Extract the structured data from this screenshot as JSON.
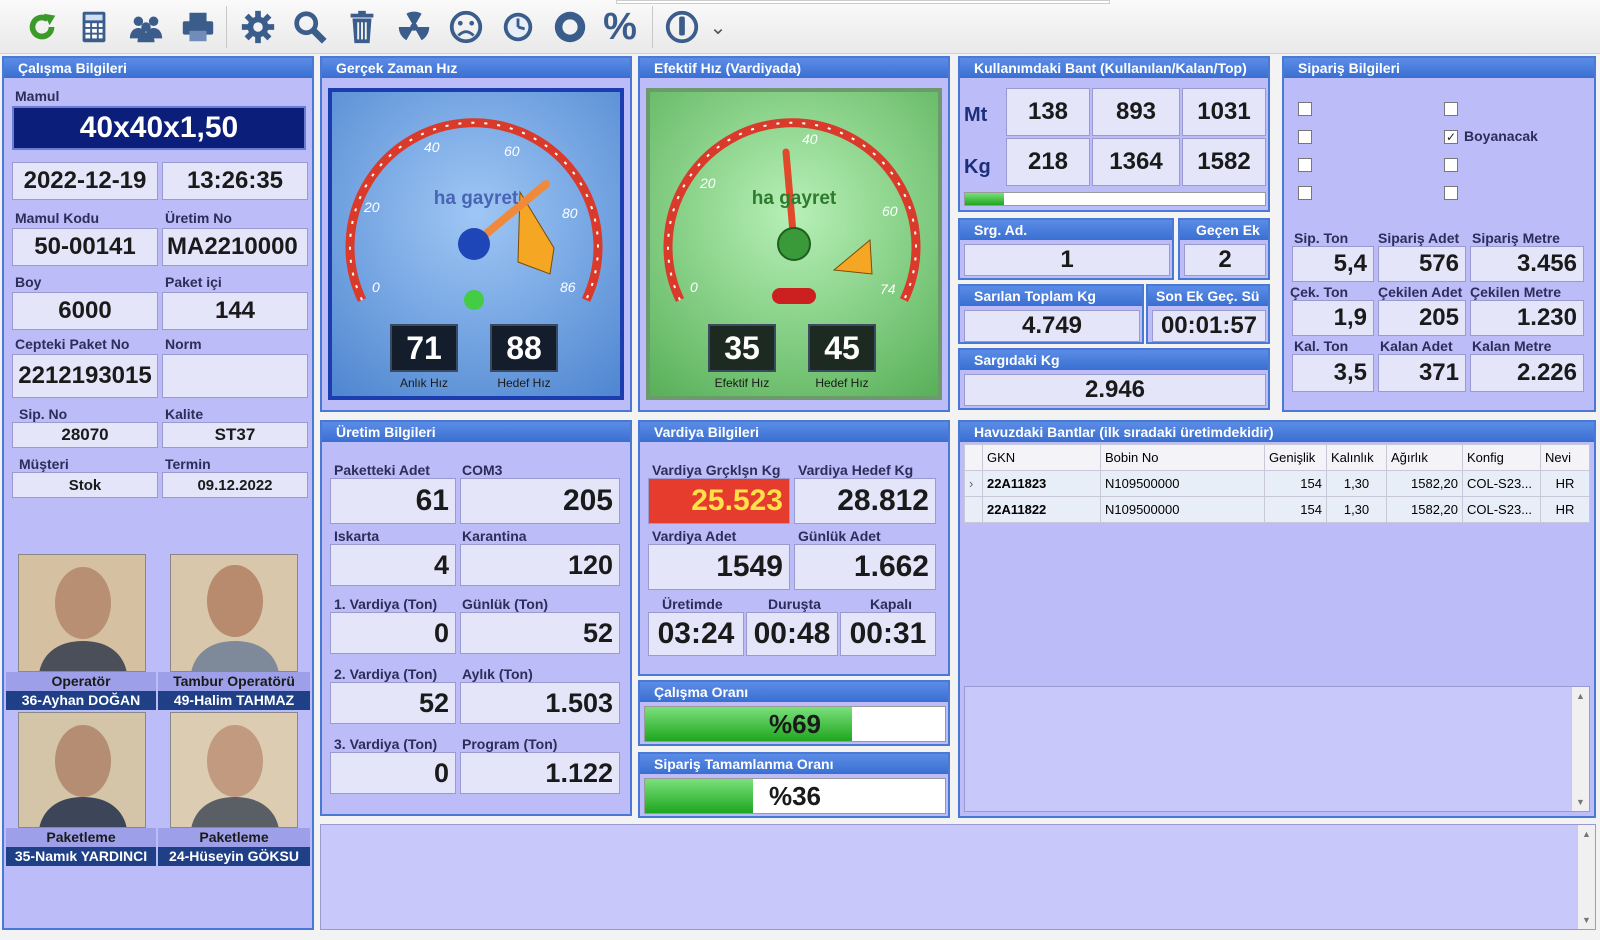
{
  "toolbar": {
    "icons": [
      "refresh-icon",
      "calculator-icon",
      "users-icon",
      "printer-icon",
      "gear-icon",
      "search-icon",
      "trash-icon",
      "radiation-icon",
      "sad-face-icon",
      "clock-icon",
      "record-icon",
      "percent-icon",
      "power-icon",
      "chevron-down-icon"
    ],
    "percent_symbol": "%",
    "chevron": "⌄"
  },
  "calisma": {
    "title": "Çalışma Bilgileri",
    "mamul_label": "Mamul",
    "mamul": "40x40x1,50",
    "date": "2022-12-19",
    "time": "13:26:35",
    "mamul_kodu_label": "Mamul Kodu",
    "mamul_kodu": "50-00141",
    "uretim_no_label": "Üretim No",
    "uretim_no": "MA2210000",
    "boy_label": "Boy",
    "boy": "6000",
    "paket_ici_label": "Paket içi",
    "paket_ici": "144",
    "cepteki_label": "Cepteki Paket No",
    "cepteki": "2212193015",
    "norm_label": "Norm",
    "norm": "",
    "sip_no_label": "Sip. No",
    "sip_no": "28070",
    "kalite_label": "Kalite",
    "kalite": "ST37",
    "musteri_label": "Müşteri",
    "musteri": "Stok",
    "termin_label": "Termin",
    "termin": "09.12.2022",
    "people": [
      {
        "role": "Operatör",
        "name": "36-Ayhan DOĞAN"
      },
      {
        "role": "Tambur Operatörü",
        "name": "49-Halim TAHMAZ"
      },
      {
        "role": "Paketleme",
        "name": "35-Namık YARDINCI"
      },
      {
        "role": "Paketleme",
        "name": "24-Hüseyin GÖKSU"
      }
    ]
  },
  "gercek": {
    "title": "Gerçek Zaman Hız",
    "slogan": "ha gayret",
    "anlik": "71",
    "hedef": "88",
    "anlik_label": "Anlık Hız",
    "hedef_label": "Hedef Hız",
    "ticks": [
      "0",
      "20",
      "40",
      "60",
      "80",
      "86"
    ]
  },
  "efektif": {
    "title": "Efektif Hız (Vardiyada)",
    "slogan": "ha gayret",
    "efektif": "35",
    "hedef": "45",
    "efektif_label": "Efektif Hız",
    "hedef_label": "Hedef Hız",
    "ticks": [
      "0",
      "20",
      "40",
      "60",
      "74"
    ]
  },
  "bant": {
    "title": "Kullanımdaki Bant (Kullanılan/Kalan/Top)",
    "mt_label": "Mt",
    "kg_label": "Kg",
    "mt": [
      "138",
      "893",
      "1031"
    ],
    "kg": [
      "218",
      "1364",
      "1582"
    ],
    "progress": 0.13,
    "srg_label": "Srg. Ad.",
    "srg": "1",
    "gecen_label": "Geçen Ek",
    "gecen": "2",
    "sarilan_label": "Sarılan Toplam Kg",
    "sarilan": "4.749",
    "son_label": "Son Ek Geç. Sü",
    "son": "00:01:57",
    "sargidaki_label": "Sargıdaki Kg",
    "sargidaki": "2.946"
  },
  "siparis": {
    "title": "Sipariş Bilgileri",
    "boyanacak": "Boyanacak",
    "check_mark": "✓",
    "checks": [
      false,
      false,
      false,
      false,
      false,
      true,
      false,
      false
    ],
    "sip_ton_label": "Sip. Ton",
    "sip_ton": "5,4",
    "sip_adet_label": "Sipariş Adet",
    "sip_adet": "576",
    "sip_metre_label": "Sipariş Metre",
    "sip_metre": "3.456",
    "cek_ton_label": "Çek. Ton",
    "cek_ton": "1,9",
    "cek_adet_label": "Çekilen Adet",
    "cek_adet": "205",
    "cek_metre_label": "Çekilen Metre",
    "cek_metre": "1.230",
    "kal_ton_label": "Kal. Ton",
    "kal_ton": "3,5",
    "kal_adet_label": "Kalan Adet",
    "kal_adet": "371",
    "kal_metre_label": "Kalan Metre",
    "kal_metre": "2.226"
  },
  "uretim": {
    "title": "Üretim Bilgileri",
    "paketteki_label": "Paketteki Adet",
    "paketteki": "61",
    "com3_label": "COM3",
    "com3": "205",
    "iskarta_label": "Iskarta",
    "iskarta": "4",
    "karantina_label": "Karantina",
    "karantina": "120",
    "v1_label": "1. Vardiya (Ton)",
    "v1": "0",
    "gunluk_label": "Günlük (Ton)",
    "gunluk": "52",
    "v2_label": "2. Vardiya (Ton)",
    "v2": "52",
    "aylik_label": "Aylık (Ton)",
    "aylik": "1.503",
    "v3_label": "3. Vardiya (Ton)",
    "v3": "0",
    "program_label": "Program (Ton)",
    "program": "1.122"
  },
  "vardiya": {
    "title": "Vardiya Bilgileri",
    "grck_label": "Vardiya Grçklşn Kg",
    "grck": "25.523",
    "hedef_label": "Vardiya Hedef Kg",
    "hedef": "28.812",
    "adet_label": "Vardiya Adet",
    "adet": "1549",
    "gunluk_label": "Günlük Adet",
    "gunluk": "1.662",
    "uretimde_label": "Üretimde",
    "uretimde": "03:24",
    "durusta_label": "Duruşta",
    "durusta": "00:48",
    "kapali_label": "Kapalı",
    "kapali": "00:31"
  },
  "calisma_orani": {
    "title": "Çalışma Oranı",
    "text": "%69",
    "value": 0.69
  },
  "siparis_orani": {
    "title": "Sipariş Tamamlanma Oranı",
    "text": "%36",
    "value": 0.36
  },
  "havuz": {
    "title": "Havuzdaki Bantlar (ilk sıradaki üretimdekidir)",
    "columns": [
      "GKN",
      "Bobin No",
      "Genişlik",
      "Kalınlık",
      "Ağırlık",
      "Konfig",
      "Nevi"
    ],
    "rows": [
      {
        "marker": "›",
        "gkn": "22A11823",
        "bobin": "N109500000",
        "genislik": "154",
        "kalinlik": "1,30",
        "agirlik": "1582,20",
        "konfig": "COL-S23...",
        "nevi": "HR"
      },
      {
        "marker": "",
        "gkn": "22A11822",
        "bobin": "N109500000",
        "genislik": "154",
        "kalinlik": "1,30",
        "agirlik": "1582,20",
        "konfig": "COL-S23...",
        "nevi": "HR"
      }
    ],
    "scroll_up": "▲",
    "scroll_down": "▼"
  },
  "colors": {
    "panel_bg": "#bcbcf8",
    "header": "#3a6fd2",
    "mamul_bg": "#0a1e7a",
    "alert": "#e63c2e",
    "alert_text": "#ffe14a"
  }
}
